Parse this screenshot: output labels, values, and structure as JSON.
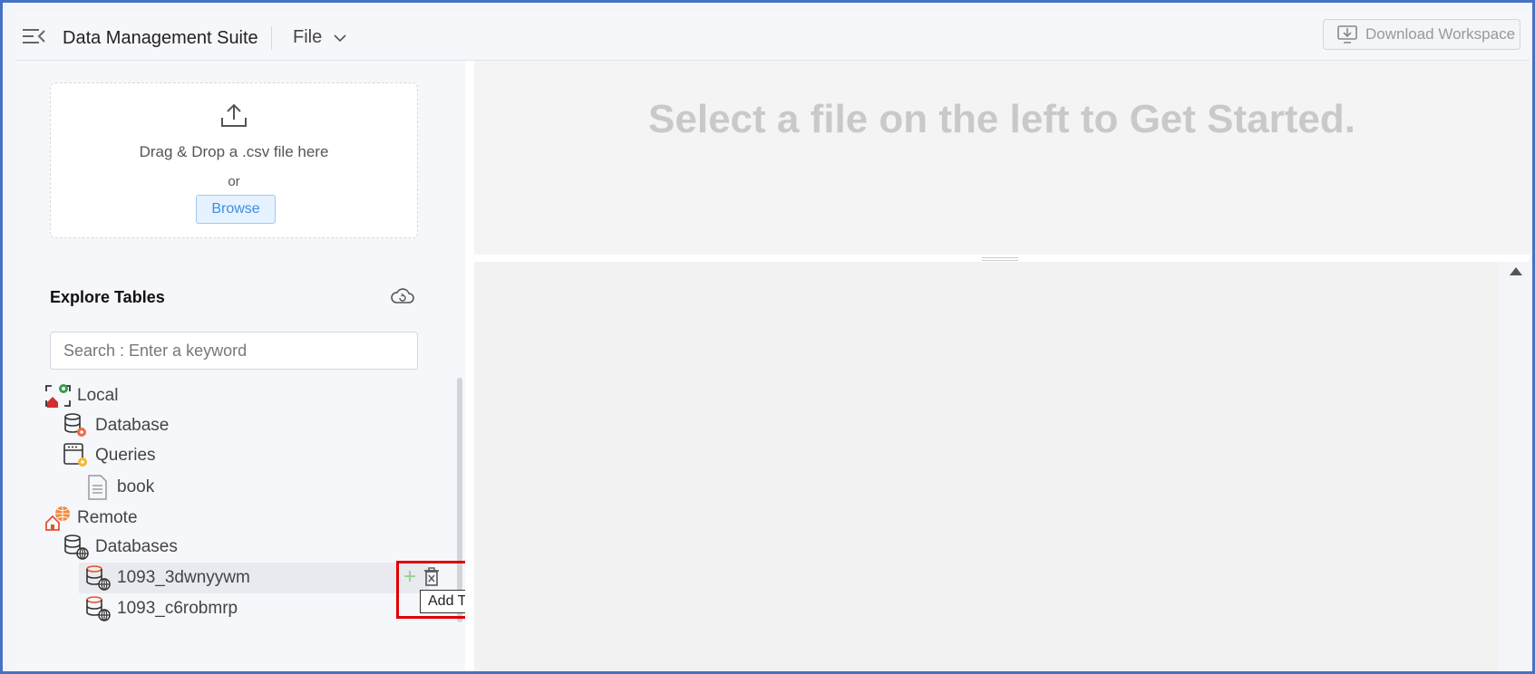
{
  "header": {
    "app_title": "Data Management Suite",
    "file_menu_label": "File",
    "download_label": "Download Workspace"
  },
  "upload": {
    "drop_text": "Drag & Drop a .csv file here",
    "or_text": "or",
    "browse_label": "Browse"
  },
  "explore": {
    "title": "Explore Tables",
    "search_placeholder": "Search : Enter a keyword"
  },
  "tree": {
    "local_label": "Local",
    "local_database_label": "Database",
    "local_queries_label": "Queries",
    "query_book_label": "book",
    "remote_label": "Remote",
    "remote_databases_label": "Databases",
    "remote_db_items": [
      "1093_3dwnyywm",
      "1093_c6robmrp"
    ]
  },
  "tooltip": {
    "text": "Add Table"
  },
  "main": {
    "prompt": "Select a file on the left to Get Started."
  },
  "colors": {
    "accent": "#3d8fe0",
    "highlight_box": "#e00000",
    "frame": "#4472c4"
  }
}
